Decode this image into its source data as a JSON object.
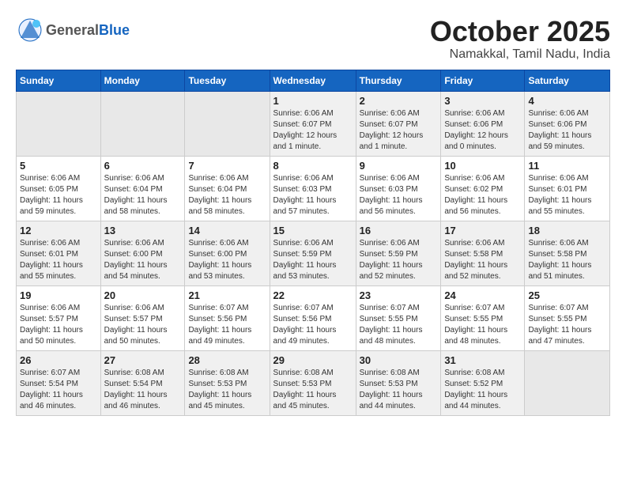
{
  "logo": {
    "general": "General",
    "blue": "Blue"
  },
  "title": {
    "month_year": "October 2025",
    "location": "Namakkal, Tamil Nadu, India"
  },
  "weekdays": [
    "Sunday",
    "Monday",
    "Tuesday",
    "Wednesday",
    "Thursday",
    "Friday",
    "Saturday"
  ],
  "weeks": [
    [
      {
        "day": "",
        "detail": ""
      },
      {
        "day": "",
        "detail": ""
      },
      {
        "day": "",
        "detail": ""
      },
      {
        "day": "1",
        "detail": "Sunrise: 6:06 AM\nSunset: 6:07 PM\nDaylight: 12 hours\nand 1 minute."
      },
      {
        "day": "2",
        "detail": "Sunrise: 6:06 AM\nSunset: 6:07 PM\nDaylight: 12 hours\nand 1 minute."
      },
      {
        "day": "3",
        "detail": "Sunrise: 6:06 AM\nSunset: 6:06 PM\nDaylight: 12 hours\nand 0 minutes."
      },
      {
        "day": "4",
        "detail": "Sunrise: 6:06 AM\nSunset: 6:06 PM\nDaylight: 11 hours\nand 59 minutes."
      }
    ],
    [
      {
        "day": "5",
        "detail": "Sunrise: 6:06 AM\nSunset: 6:05 PM\nDaylight: 11 hours\nand 59 minutes."
      },
      {
        "day": "6",
        "detail": "Sunrise: 6:06 AM\nSunset: 6:04 PM\nDaylight: 11 hours\nand 58 minutes."
      },
      {
        "day": "7",
        "detail": "Sunrise: 6:06 AM\nSunset: 6:04 PM\nDaylight: 11 hours\nand 58 minutes."
      },
      {
        "day": "8",
        "detail": "Sunrise: 6:06 AM\nSunset: 6:03 PM\nDaylight: 11 hours\nand 57 minutes."
      },
      {
        "day": "9",
        "detail": "Sunrise: 6:06 AM\nSunset: 6:03 PM\nDaylight: 11 hours\nand 56 minutes."
      },
      {
        "day": "10",
        "detail": "Sunrise: 6:06 AM\nSunset: 6:02 PM\nDaylight: 11 hours\nand 56 minutes."
      },
      {
        "day": "11",
        "detail": "Sunrise: 6:06 AM\nSunset: 6:01 PM\nDaylight: 11 hours\nand 55 minutes."
      }
    ],
    [
      {
        "day": "12",
        "detail": "Sunrise: 6:06 AM\nSunset: 6:01 PM\nDaylight: 11 hours\nand 55 minutes."
      },
      {
        "day": "13",
        "detail": "Sunrise: 6:06 AM\nSunset: 6:00 PM\nDaylight: 11 hours\nand 54 minutes."
      },
      {
        "day": "14",
        "detail": "Sunrise: 6:06 AM\nSunset: 6:00 PM\nDaylight: 11 hours\nand 53 minutes."
      },
      {
        "day": "15",
        "detail": "Sunrise: 6:06 AM\nSunset: 5:59 PM\nDaylight: 11 hours\nand 53 minutes."
      },
      {
        "day": "16",
        "detail": "Sunrise: 6:06 AM\nSunset: 5:59 PM\nDaylight: 11 hours\nand 52 minutes."
      },
      {
        "day": "17",
        "detail": "Sunrise: 6:06 AM\nSunset: 5:58 PM\nDaylight: 11 hours\nand 52 minutes."
      },
      {
        "day": "18",
        "detail": "Sunrise: 6:06 AM\nSunset: 5:58 PM\nDaylight: 11 hours\nand 51 minutes."
      }
    ],
    [
      {
        "day": "19",
        "detail": "Sunrise: 6:06 AM\nSunset: 5:57 PM\nDaylight: 11 hours\nand 50 minutes."
      },
      {
        "day": "20",
        "detail": "Sunrise: 6:06 AM\nSunset: 5:57 PM\nDaylight: 11 hours\nand 50 minutes."
      },
      {
        "day": "21",
        "detail": "Sunrise: 6:07 AM\nSunset: 5:56 PM\nDaylight: 11 hours\nand 49 minutes."
      },
      {
        "day": "22",
        "detail": "Sunrise: 6:07 AM\nSunset: 5:56 PM\nDaylight: 11 hours\nand 49 minutes."
      },
      {
        "day": "23",
        "detail": "Sunrise: 6:07 AM\nSunset: 5:55 PM\nDaylight: 11 hours\nand 48 minutes."
      },
      {
        "day": "24",
        "detail": "Sunrise: 6:07 AM\nSunset: 5:55 PM\nDaylight: 11 hours\nand 48 minutes."
      },
      {
        "day": "25",
        "detail": "Sunrise: 6:07 AM\nSunset: 5:55 PM\nDaylight: 11 hours\nand 47 minutes."
      }
    ],
    [
      {
        "day": "26",
        "detail": "Sunrise: 6:07 AM\nSunset: 5:54 PM\nDaylight: 11 hours\nand 46 minutes."
      },
      {
        "day": "27",
        "detail": "Sunrise: 6:08 AM\nSunset: 5:54 PM\nDaylight: 11 hours\nand 46 minutes."
      },
      {
        "day": "28",
        "detail": "Sunrise: 6:08 AM\nSunset: 5:53 PM\nDaylight: 11 hours\nand 45 minutes."
      },
      {
        "day": "29",
        "detail": "Sunrise: 6:08 AM\nSunset: 5:53 PM\nDaylight: 11 hours\nand 45 minutes."
      },
      {
        "day": "30",
        "detail": "Sunrise: 6:08 AM\nSunset: 5:53 PM\nDaylight: 11 hours\nand 44 minutes."
      },
      {
        "day": "31",
        "detail": "Sunrise: 6:08 AM\nSunset: 5:52 PM\nDaylight: 11 hours\nand 44 minutes."
      },
      {
        "day": "",
        "detail": ""
      }
    ]
  ]
}
